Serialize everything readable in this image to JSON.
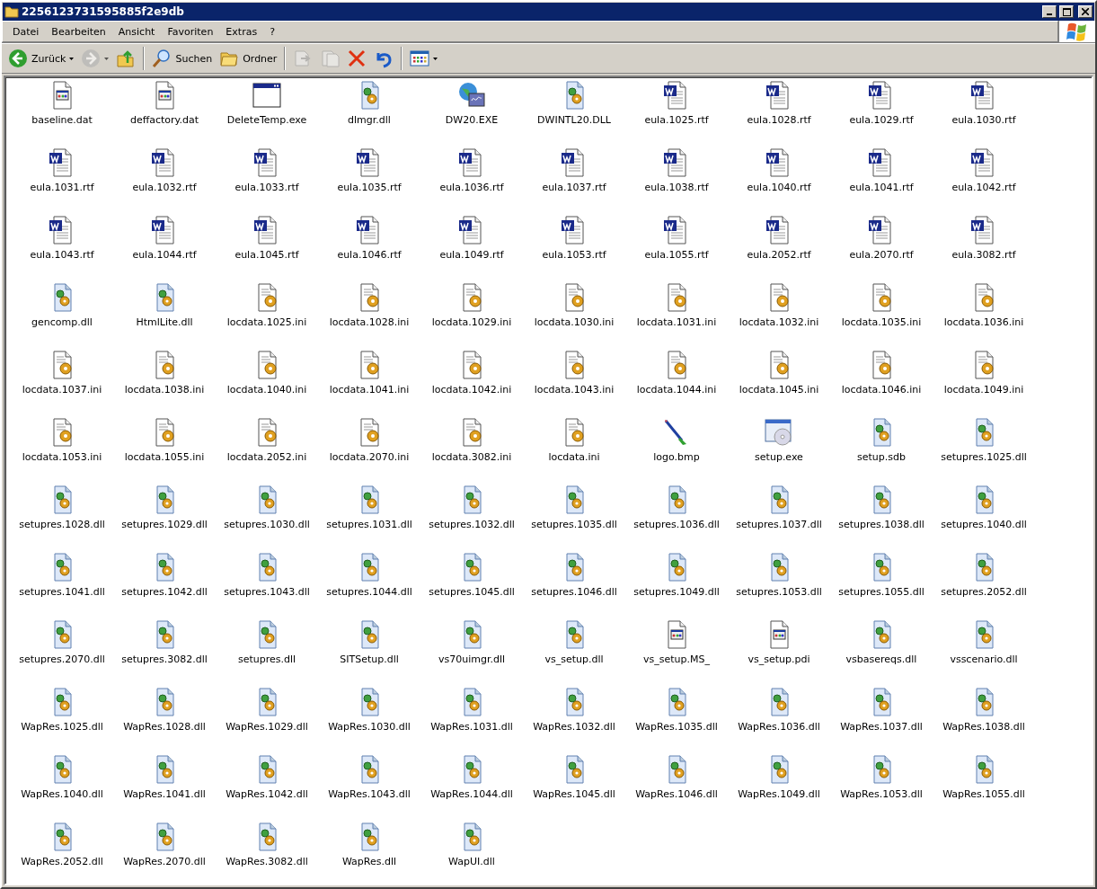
{
  "window": {
    "title": "2256123731595885f2e9db"
  },
  "menu": [
    "Datei",
    "Bearbeiten",
    "Ansicht",
    "Favoriten",
    "Extras",
    "?"
  ],
  "toolbar": [
    {
      "kind": "back",
      "label": "Zurück",
      "disabled": false,
      "dropdown": true
    },
    {
      "kind": "forward",
      "disabled": true,
      "dropdown": true
    },
    {
      "kind": "up",
      "disabled": false
    },
    {
      "kind": "separator"
    },
    {
      "kind": "search",
      "label": "Suchen",
      "disabled": false
    },
    {
      "kind": "folders",
      "label": "Ordner",
      "disabled": false
    },
    {
      "kind": "separator"
    },
    {
      "kind": "move",
      "disabled": true
    },
    {
      "kind": "copy",
      "disabled": true
    },
    {
      "kind": "delete",
      "disabled": false
    },
    {
      "kind": "undo",
      "disabled": false
    },
    {
      "kind": "separator"
    },
    {
      "kind": "views",
      "disabled": false,
      "dropdown": true
    }
  ],
  "files": [
    {
      "name": "baseline.dat",
      "kind": "dat"
    },
    {
      "name": "deffactory.dat",
      "kind": "dat"
    },
    {
      "name": "DeleteTemp.exe",
      "kind": "exe"
    },
    {
      "name": "dlmgr.dll",
      "kind": "dll"
    },
    {
      "name": "DW20.EXE",
      "kind": "globe"
    },
    {
      "name": "DWINTL20.DLL",
      "kind": "dll"
    },
    {
      "name": "eula.1025.rtf",
      "kind": "rtf"
    },
    {
      "name": "eula.1028.rtf",
      "kind": "rtf"
    },
    {
      "name": "eula.1029.rtf",
      "kind": "rtf"
    },
    {
      "name": "eula.1030.rtf",
      "kind": "rtf"
    },
    {
      "name": "eula.1031.rtf",
      "kind": "rtf"
    },
    {
      "name": "eula.1032.rtf",
      "kind": "rtf"
    },
    {
      "name": "eula.1033.rtf",
      "kind": "rtf"
    },
    {
      "name": "eula.1035.rtf",
      "kind": "rtf"
    },
    {
      "name": "eula.1036.rtf",
      "kind": "rtf"
    },
    {
      "name": "eula.1037.rtf",
      "kind": "rtf"
    },
    {
      "name": "eula.1038.rtf",
      "kind": "rtf"
    },
    {
      "name": "eula.1040.rtf",
      "kind": "rtf"
    },
    {
      "name": "eula.1041.rtf",
      "kind": "rtf"
    },
    {
      "name": "eula.1042.rtf",
      "kind": "rtf"
    },
    {
      "name": "eula.1043.rtf",
      "kind": "rtf"
    },
    {
      "name": "eula.1044.rtf",
      "kind": "rtf"
    },
    {
      "name": "eula.1045.rtf",
      "kind": "rtf"
    },
    {
      "name": "eula.1046.rtf",
      "kind": "rtf"
    },
    {
      "name": "eula.1049.rtf",
      "kind": "rtf"
    },
    {
      "name": "eula.1053.rtf",
      "kind": "rtf"
    },
    {
      "name": "eula.1055.rtf",
      "kind": "rtf"
    },
    {
      "name": "eula.2052.rtf",
      "kind": "rtf"
    },
    {
      "name": "eula.2070.rtf",
      "kind": "rtf"
    },
    {
      "name": "eula.3082.rtf",
      "kind": "rtf"
    },
    {
      "name": "gencomp.dll",
      "kind": "dll"
    },
    {
      "name": "HtmlLite.dll",
      "kind": "dll"
    },
    {
      "name": "locdata.1025.ini",
      "kind": "ini"
    },
    {
      "name": "locdata.1028.ini",
      "kind": "ini"
    },
    {
      "name": "locdata.1029.ini",
      "kind": "ini"
    },
    {
      "name": "locdata.1030.ini",
      "kind": "ini"
    },
    {
      "name": "locdata.1031.ini",
      "kind": "ini"
    },
    {
      "name": "locdata.1032.ini",
      "kind": "ini"
    },
    {
      "name": "locdata.1035.ini",
      "kind": "ini"
    },
    {
      "name": "locdata.1036.ini",
      "kind": "ini"
    },
    {
      "name": "locdata.1037.ini",
      "kind": "ini"
    },
    {
      "name": "locdata.1038.ini",
      "kind": "ini"
    },
    {
      "name": "locdata.1040.ini",
      "kind": "ini"
    },
    {
      "name": "locdata.1041.ini",
      "kind": "ini"
    },
    {
      "name": "locdata.1042.ini",
      "kind": "ini"
    },
    {
      "name": "locdata.1043.ini",
      "kind": "ini"
    },
    {
      "name": "locdata.1044.ini",
      "kind": "ini"
    },
    {
      "name": "locdata.1045.ini",
      "kind": "ini"
    },
    {
      "name": "locdata.1046.ini",
      "kind": "ini"
    },
    {
      "name": "locdata.1049.ini",
      "kind": "ini"
    },
    {
      "name": "locdata.1053.ini",
      "kind": "ini"
    },
    {
      "name": "locdata.1055.ini",
      "kind": "ini"
    },
    {
      "name": "locdata.2052.ini",
      "kind": "ini"
    },
    {
      "name": "locdata.2070.ini",
      "kind": "ini"
    },
    {
      "name": "locdata.3082.ini",
      "kind": "ini"
    },
    {
      "name": "locdata.ini",
      "kind": "ini"
    },
    {
      "name": "logo.bmp",
      "kind": "bmp"
    },
    {
      "name": "setup.exe",
      "kind": "setup"
    },
    {
      "name": "setup.sdb",
      "kind": "dll"
    },
    {
      "name": "setupres.1025.dll",
      "kind": "dll"
    },
    {
      "name": "setupres.1028.dll",
      "kind": "dll"
    },
    {
      "name": "setupres.1029.dll",
      "kind": "dll"
    },
    {
      "name": "setupres.1030.dll",
      "kind": "dll"
    },
    {
      "name": "setupres.1031.dll",
      "kind": "dll"
    },
    {
      "name": "setupres.1032.dll",
      "kind": "dll"
    },
    {
      "name": "setupres.1035.dll",
      "kind": "dll"
    },
    {
      "name": "setupres.1036.dll",
      "kind": "dll"
    },
    {
      "name": "setupres.1037.dll",
      "kind": "dll"
    },
    {
      "name": "setupres.1038.dll",
      "kind": "dll"
    },
    {
      "name": "setupres.1040.dll",
      "kind": "dll"
    },
    {
      "name": "setupres.1041.dll",
      "kind": "dll"
    },
    {
      "name": "setupres.1042.dll",
      "kind": "dll"
    },
    {
      "name": "setupres.1043.dll",
      "kind": "dll"
    },
    {
      "name": "setupres.1044.dll",
      "kind": "dll"
    },
    {
      "name": "setupres.1045.dll",
      "kind": "dll"
    },
    {
      "name": "setupres.1046.dll",
      "kind": "dll"
    },
    {
      "name": "setupres.1049.dll",
      "kind": "dll"
    },
    {
      "name": "setupres.1053.dll",
      "kind": "dll"
    },
    {
      "name": "setupres.1055.dll",
      "kind": "dll"
    },
    {
      "name": "setupres.2052.dll",
      "kind": "dll"
    },
    {
      "name": "setupres.2070.dll",
      "kind": "dll"
    },
    {
      "name": "setupres.3082.dll",
      "kind": "dll"
    },
    {
      "name": "setupres.dll",
      "kind": "dll"
    },
    {
      "name": "SITSetup.dll",
      "kind": "dll"
    },
    {
      "name": "vs70uimgr.dll",
      "kind": "dll"
    },
    {
      "name": "vs_setup.dll",
      "kind": "dll"
    },
    {
      "name": "vs_setup.MS_",
      "kind": "dat"
    },
    {
      "name": "vs_setup.pdi",
      "kind": "dat"
    },
    {
      "name": "vsbasereqs.dll",
      "kind": "dll"
    },
    {
      "name": "vsscenario.dll",
      "kind": "dll"
    },
    {
      "name": "WapRes.1025.dll",
      "kind": "dll"
    },
    {
      "name": "WapRes.1028.dll",
      "kind": "dll"
    },
    {
      "name": "WapRes.1029.dll",
      "kind": "dll"
    },
    {
      "name": "WapRes.1030.dll",
      "kind": "dll"
    },
    {
      "name": "WapRes.1031.dll",
      "kind": "dll"
    },
    {
      "name": "WapRes.1032.dll",
      "kind": "dll"
    },
    {
      "name": "WapRes.1035.dll",
      "kind": "dll"
    },
    {
      "name": "WapRes.1036.dll",
      "kind": "dll"
    },
    {
      "name": "WapRes.1037.dll",
      "kind": "dll"
    },
    {
      "name": "WapRes.1038.dll",
      "kind": "dll"
    },
    {
      "name": "WapRes.1040.dll",
      "kind": "dll"
    },
    {
      "name": "WapRes.1041.dll",
      "kind": "dll"
    },
    {
      "name": "WapRes.1042.dll",
      "kind": "dll"
    },
    {
      "name": "WapRes.1043.dll",
      "kind": "dll"
    },
    {
      "name": "WapRes.1044.dll",
      "kind": "dll"
    },
    {
      "name": "WapRes.1045.dll",
      "kind": "dll"
    },
    {
      "name": "WapRes.1046.dll",
      "kind": "dll"
    },
    {
      "name": "WapRes.1049.dll",
      "kind": "dll"
    },
    {
      "name": "WapRes.1053.dll",
      "kind": "dll"
    },
    {
      "name": "WapRes.1055.dll",
      "kind": "dll"
    },
    {
      "name": "WapRes.2052.dll",
      "kind": "dll"
    },
    {
      "name": "WapRes.2070.dll",
      "kind": "dll"
    },
    {
      "name": "WapRes.3082.dll",
      "kind": "dll"
    },
    {
      "name": "WapRes.dll",
      "kind": "dll"
    },
    {
      "name": "WapUI.dll",
      "kind": "dll"
    }
  ]
}
